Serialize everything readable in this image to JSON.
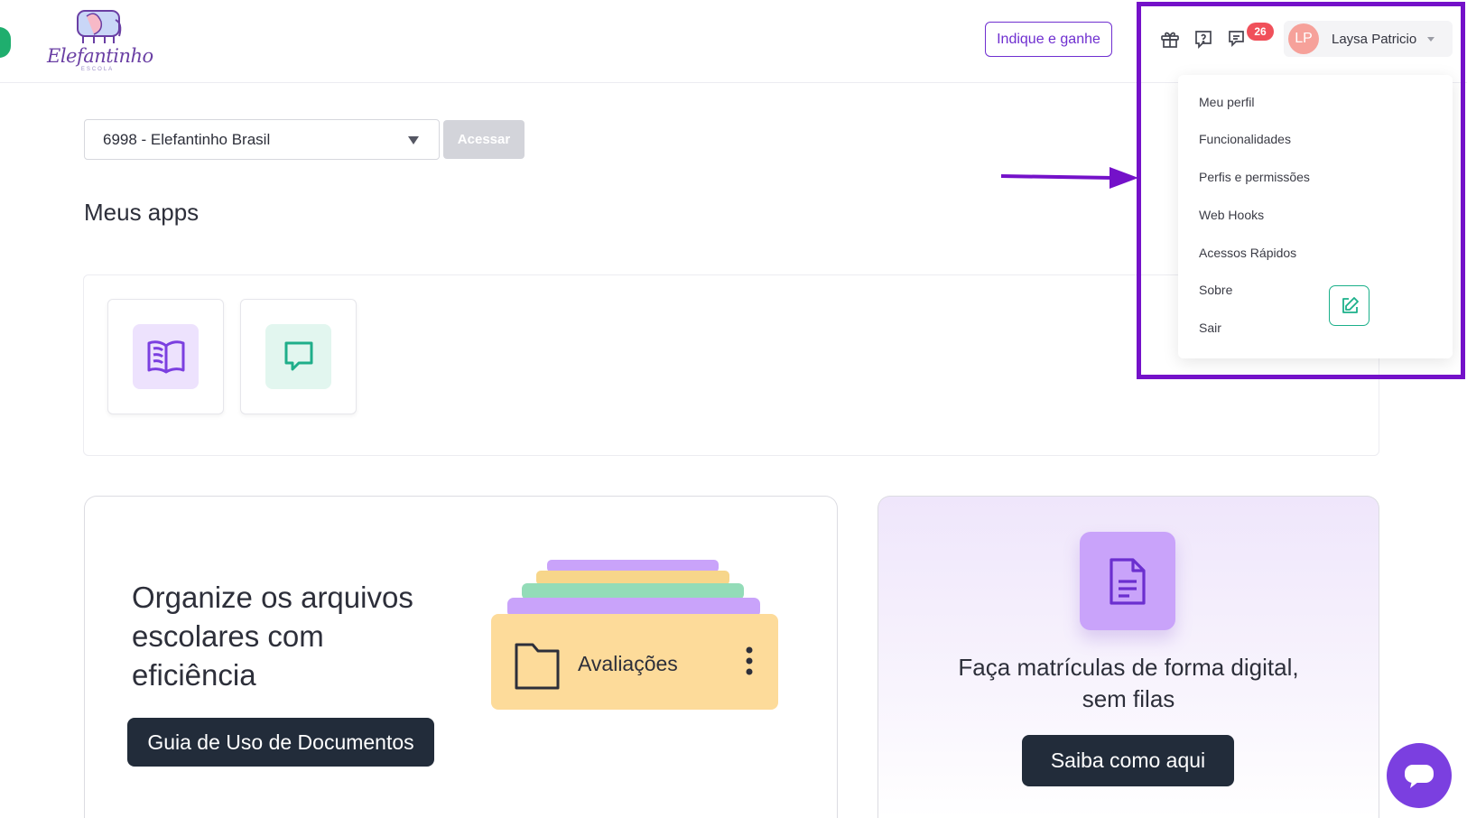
{
  "brand": {
    "name": "Elefantinho",
    "sub": "ESCOLA"
  },
  "header": {
    "indique_label": "Indique e ganhe",
    "notification_count": "26",
    "user": {
      "initials": "LP",
      "name": "Laysa Patricio"
    }
  },
  "menu": {
    "items": [
      "Meu perfil",
      "Funcionalidades",
      "Perfis e permissões",
      "Web Hooks",
      "Acessos Rápidos",
      "Sobre",
      "Sair"
    ]
  },
  "school_select": {
    "value": "6998 - Elefantinho Brasil",
    "button": "Acessar"
  },
  "apps": {
    "title": "Meus apps"
  },
  "promo_docs": {
    "heading": "Organize os arquivos escolares com eficiência",
    "folder_label": "Avaliações",
    "button": "Guia de Uso de Documentos"
  },
  "promo_enroll": {
    "text": "Faça matrículas de forma digital, sem filas",
    "button": "Saiba como aqui"
  },
  "colors": {
    "accent": "#6f2fd0",
    "highlight": "#7411c9",
    "badge": "#f0505a",
    "dark": "#222c3a"
  }
}
